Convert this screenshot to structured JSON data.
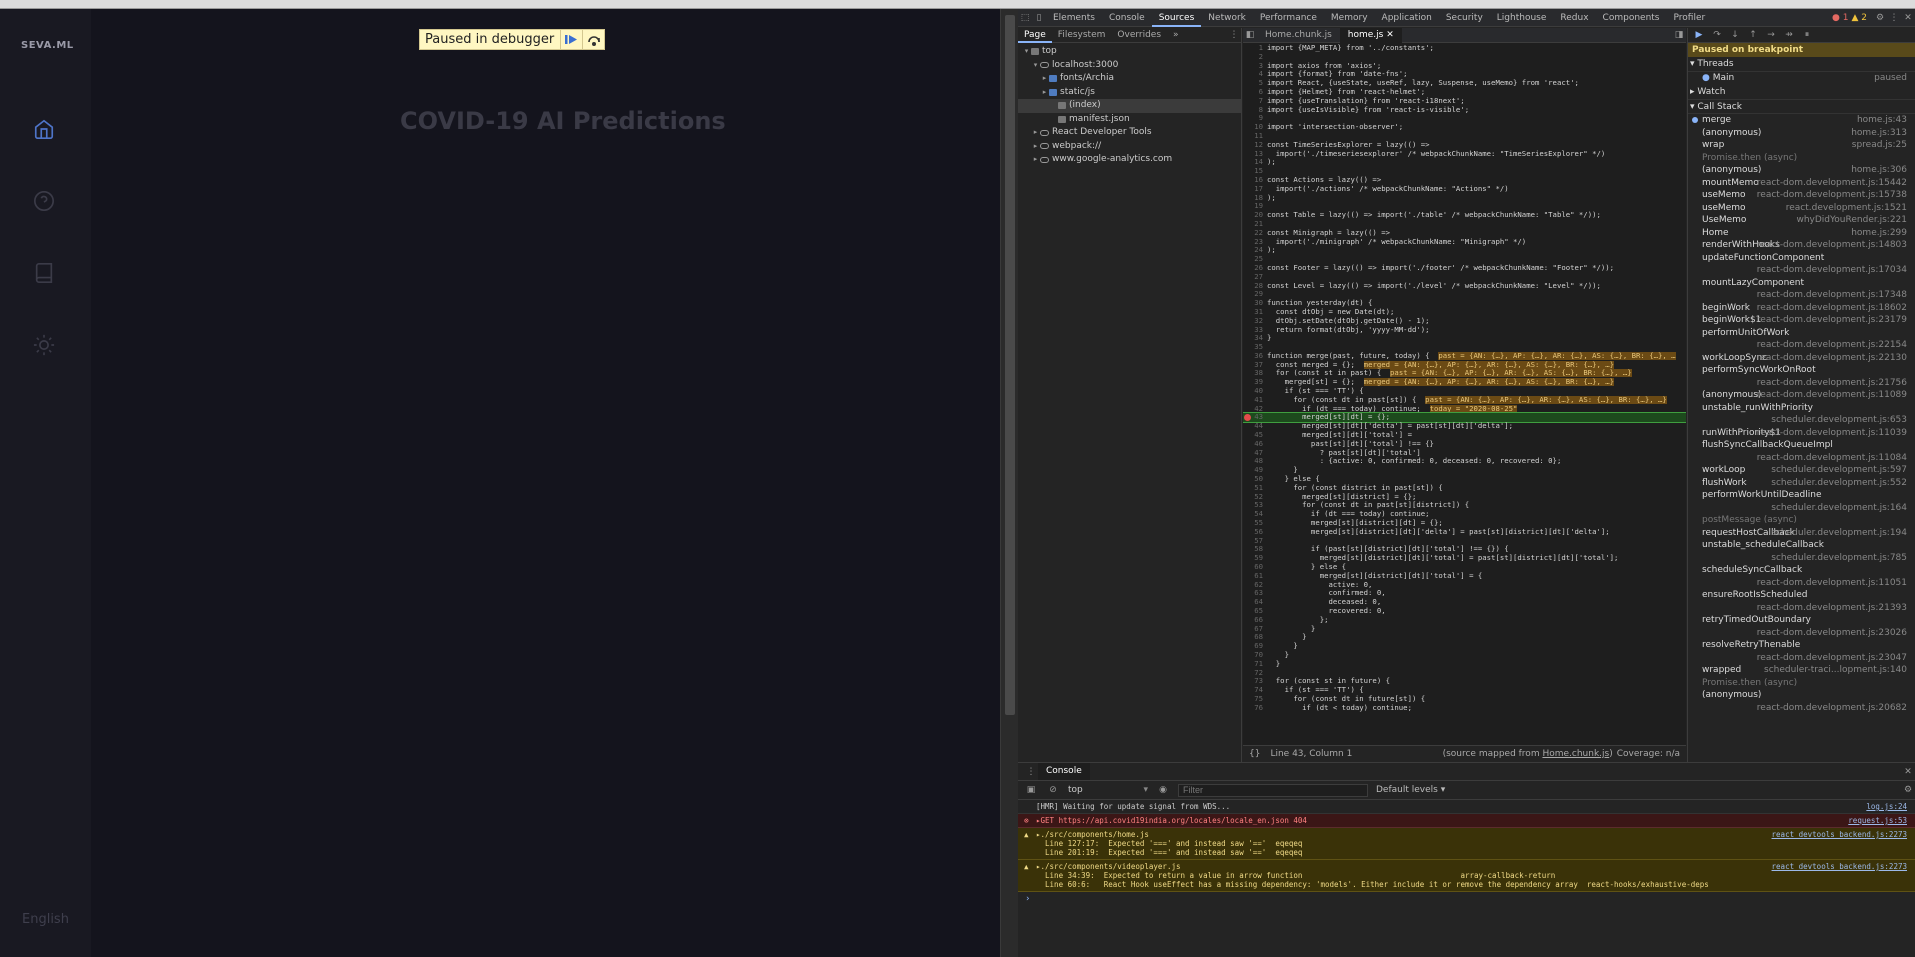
{
  "page": {
    "logo": "SEVA.ML",
    "title": "COVID-19 AI Predictions",
    "language": "English",
    "nav_icons": [
      "home-icon",
      "help-icon",
      "book-icon",
      "sun-icon"
    ]
  },
  "paused_overlay": {
    "label": "Paused in debugger"
  },
  "devtools": {
    "tabs": [
      "Elements",
      "Console",
      "Sources",
      "Network",
      "Performance",
      "Memory",
      "Application",
      "Security",
      "Lighthouse",
      "Redux",
      "Components",
      "Profiler"
    ],
    "active_tab": "Sources",
    "issues": {
      "errors": "1",
      "warnings": "2"
    },
    "navigator": {
      "tabs": [
        "Page",
        "Filesystem",
        "Overrides"
      ],
      "tree": [
        {
          "label": "top",
          "depth": 0,
          "kind": "frame"
        },
        {
          "label": "localhost:3000",
          "depth": 1,
          "kind": "cloud"
        },
        {
          "label": "fonts/Archia",
          "depth": 2,
          "kind": "folder"
        },
        {
          "label": "static/js",
          "depth": 2,
          "kind": "folder"
        },
        {
          "label": "(index)",
          "depth": 3,
          "kind": "file",
          "selected": true
        },
        {
          "label": "manifest.json",
          "depth": 3,
          "kind": "file"
        },
        {
          "label": "React Developer Tools",
          "depth": 1,
          "kind": "cloud"
        },
        {
          "label": "webpack://",
          "depth": 1,
          "kind": "cloud"
        },
        {
          "label": "www.google-analytics.com",
          "depth": 1,
          "kind": "cloud"
        }
      ]
    },
    "editor": {
      "tabs": [
        "Home.chunk.js",
        "home.js"
      ],
      "active_tab": "home.js",
      "status_position": "Line 43, Column 1",
      "status_source_prefix": "(source mapped from ",
      "status_source_link": "Home.chunk.js",
      "status_source_suffix": ")",
      "status_coverage": "Coverage: n/a",
      "lines": [
        {
          "n": "1",
          "t": "import {MAP_META} from '../constants';"
        },
        {
          "n": "2",
          "t": ""
        },
        {
          "n": "3",
          "t": "import axios from 'axios';"
        },
        {
          "n": "4",
          "t": "import {format} from 'date-fns';"
        },
        {
          "n": "5",
          "t": "import React, {useState, useRef, lazy, Suspense, useMemo} from 'react';"
        },
        {
          "n": "6",
          "t": "import {Helmet} from 'react-helmet';"
        },
        {
          "n": "7",
          "t": "import {useTranslation} from 'react-i18next';"
        },
        {
          "n": "8",
          "t": "import {useIsVisible} from 'react-is-visible';"
        },
        {
          "n": "9",
          "t": ""
        },
        {
          "n": "10",
          "t": "import 'intersection-observer';"
        },
        {
          "n": "11",
          "t": ""
        },
        {
          "n": "12",
          "t": "const TimeSeriesExplorer = lazy(() =>"
        },
        {
          "n": "13",
          "t": "  import('./timeseriesexplorer' /* webpackChunkName: \"TimeSeriesExplorer\" */)"
        },
        {
          "n": "14",
          "t": ");"
        },
        {
          "n": "15",
          "t": ""
        },
        {
          "n": "16",
          "t": "const Actions = lazy(() =>"
        },
        {
          "n": "17",
          "t": "  import('./actions' /* webpackChunkName: \"Actions\" */)"
        },
        {
          "n": "18",
          "t": ");"
        },
        {
          "n": "19",
          "t": ""
        },
        {
          "n": "20",
          "t": "const Table = lazy(() => import('./table' /* webpackChunkName: \"Table\" */));"
        },
        {
          "n": "21",
          "t": ""
        },
        {
          "n": "22",
          "t": "const Minigraph = lazy(() =>"
        },
        {
          "n": "23",
          "t": "  import('./minigraph' /* webpackChunkName: \"Minigraph\" */)"
        },
        {
          "n": "24",
          "t": ");"
        },
        {
          "n": "25",
          "t": ""
        },
        {
          "n": "26",
          "t": "const Footer = lazy(() => import('./footer' /* webpackChunkName: \"Footer\" */));"
        },
        {
          "n": "27",
          "t": ""
        },
        {
          "n": "28",
          "t": "const Level = lazy(() => import('./level' /* webpackChunkName: \"Level\" */));"
        },
        {
          "n": "29",
          "t": ""
        },
        {
          "n": "30",
          "t": "function yesterday(dt) {"
        },
        {
          "n": "31",
          "t": "  const dtObj = new Date(dt);"
        },
        {
          "n": "32",
          "t": "  dtObj.setDate(dtObj.getDate() - 1);"
        },
        {
          "n": "33",
          "t": "  return format(dtObj, 'yyyy-MM-dd');"
        },
        {
          "n": "34",
          "t": "}"
        },
        {
          "n": "35",
          "t": ""
        },
        {
          "n": "36",
          "t": "function merge(past, future, today) {",
          "i": "past = {AN: {…}, AP: {…}, AR: {…}, AS: {…}, BR: {…}, …"
        },
        {
          "n": "37",
          "t": "  const merged = {};",
          "i": "merged = {AN: {…}, AP: {…}, AR: {…}, AS: {…}, BR: {…}, …}"
        },
        {
          "n": "38",
          "t": "  for (const st in past) {",
          "i": "past = {AN: {…}, AP: {…}, AR: {…}, AS: {…}, BR: {…}, …}"
        },
        {
          "n": "39",
          "t": "    merged[st] = {};",
          "i": "merged = {AN: {…}, AP: {…}, AR: {…}, AS: {…}, BR: {…}, …}"
        },
        {
          "n": "40",
          "t": "    if (st === 'TT') {"
        },
        {
          "n": "41",
          "t": "      for (const dt in past[st]) {",
          "i": "past = {AN: {…}, AP: {…}, AR: {…}, AS: {…}, BR: {…}, …}"
        },
        {
          "n": "42",
          "t": "        if (dt === today) continue;",
          "i": "today = \"2020-08-25\""
        },
        {
          "n": "43",
          "t": "        merged[st][dt] = {};",
          "paused": true
        },
        {
          "n": "44",
          "t": "        merged[st][dt]['delta'] = past[st][dt]['delta'];"
        },
        {
          "n": "45",
          "t": "        merged[st][dt]['total'] ="
        },
        {
          "n": "46",
          "t": "          past[st][dt]['total'] !== {}"
        },
        {
          "n": "47",
          "t": "            ? past[st][dt]['total']"
        },
        {
          "n": "48",
          "t": "            : {active: 0, confirmed: 0, deceased: 0, recovered: 0};"
        },
        {
          "n": "49",
          "t": "      }"
        },
        {
          "n": "50",
          "t": "    } else {"
        },
        {
          "n": "51",
          "t": "      for (const district in past[st]) {"
        },
        {
          "n": "52",
          "t": "        merged[st][district] = {};"
        },
        {
          "n": "53",
          "t": "        for (const dt in past[st][district]) {"
        },
        {
          "n": "54",
          "t": "          if (dt === today) continue;"
        },
        {
          "n": "55",
          "t": "          merged[st][district][dt] = {};"
        },
        {
          "n": "56",
          "t": "          merged[st][district][dt]['delta'] = past[st][district][dt]['delta'];"
        },
        {
          "n": "57",
          "t": ""
        },
        {
          "n": "58",
          "t": "          if (past[st][district][dt]['total'] !== {}) {"
        },
        {
          "n": "59",
          "t": "            merged[st][district][dt]['total'] = past[st][district][dt]['total'];"
        },
        {
          "n": "60",
          "t": "          } else {"
        },
        {
          "n": "61",
          "t": "            merged[st][district][dt]['total'] = {"
        },
        {
          "n": "62",
          "t": "              active: 0,"
        },
        {
          "n": "63",
          "t": "              confirmed: 0,"
        },
        {
          "n": "64",
          "t": "              deceased: 0,"
        },
        {
          "n": "65",
          "t": "              recovered: 0,"
        },
        {
          "n": "66",
          "t": "            };"
        },
        {
          "n": "67",
          "t": "          }"
        },
        {
          "n": "68",
          "t": "        }"
        },
        {
          "n": "69",
          "t": "      }"
        },
        {
          "n": "70",
          "t": "    }"
        },
        {
          "n": "71",
          "t": "  }"
        },
        {
          "n": "72",
          "t": ""
        },
        {
          "n": "73",
          "t": "  for (const st in future) {"
        },
        {
          "n": "74",
          "t": "    if (st === 'TT') {"
        },
        {
          "n": "75",
          "t": "      for (const dt in future[st]) {"
        },
        {
          "n": "76",
          "t": "        if (dt < today) continue;"
        }
      ]
    },
    "debugger": {
      "paused_banner": "Paused on breakpoint",
      "threads_label": "Threads",
      "thread_name": "Main",
      "thread_state": "paused",
      "watch_label": "Watch",
      "callstack_label": "Call Stack",
      "frames": [
        {
          "fn": "merge",
          "loc": "home.js:43",
          "current": true
        },
        {
          "fn": "(anonymous)",
          "loc": "home.js:313"
        },
        {
          "fn": "wrap",
          "loc": "spread.js:25"
        },
        {
          "async": "Promise.then (async)"
        },
        {
          "fn": "(anonymous)",
          "loc": "home.js:306"
        },
        {
          "fn": "mountMemo",
          "loc": "react-dom.development.js:15442"
        },
        {
          "fn": "useMemo",
          "loc": "react-dom.development.js:15738"
        },
        {
          "fn": "useMemo",
          "loc": "react.development.js:1521"
        },
        {
          "fn": "UseMemo",
          "loc": "whyDidYouRender.js:221"
        },
        {
          "fn": "Home",
          "loc": "home.js:299"
        },
        {
          "fn": "renderWithHooks",
          "loc": "react-dom.development.js:14803"
        },
        {
          "fn": "updateFunctionComponent",
          "loc": "react-dom.development.js:17034",
          "two": true
        },
        {
          "fn": "mountLazyComponent",
          "loc": "react-dom.development.js:17348",
          "two": true
        },
        {
          "fn": "beginWork",
          "loc": "react-dom.development.js:18602"
        },
        {
          "fn": "beginWork$1",
          "loc": "react-dom.development.js:23179"
        },
        {
          "fn": "performUnitOfWork",
          "loc": "react-dom.development.js:22154",
          "two": true
        },
        {
          "fn": "workLoopSync",
          "loc": "react-dom.development.js:22130"
        },
        {
          "fn": "performSyncWorkOnRoot",
          "loc": "react-dom.development.js:21756",
          "two": true
        },
        {
          "fn": "(anonymous)",
          "loc": "react-dom.development.js:11089"
        },
        {
          "fn": "unstable_runWithPriority",
          "loc": "scheduler.development.js:653",
          "two": true
        },
        {
          "fn": "runWithPriority$1",
          "loc": "react-dom.development.js:11039"
        },
        {
          "fn": "flushSyncCallbackQueueImpl",
          "loc": "react-dom.development.js:11084",
          "two": true
        },
        {
          "fn": "workLoop",
          "loc": "scheduler.development.js:597"
        },
        {
          "fn": "flushWork",
          "loc": "scheduler.development.js:552"
        },
        {
          "fn": "performWorkUntilDeadline",
          "loc": "scheduler.development.js:164",
          "two": true
        },
        {
          "async": "postMessage (async)"
        },
        {
          "fn": "requestHostCallback",
          "loc": "scheduler.development.js:194"
        },
        {
          "fn": "unstable_scheduleCallback",
          "loc": "scheduler.development.js:785",
          "two": true
        },
        {
          "fn": "scheduleSyncCallback",
          "loc": "react-dom.development.js:11051",
          "two": true
        },
        {
          "fn": "ensureRootIsScheduled",
          "loc": "react-dom.development.js:21393",
          "two": true
        },
        {
          "fn": "retryTimedOutBoundary",
          "loc": "react-dom.development.js:23026",
          "two": true
        },
        {
          "fn": "resolveRetryThenable",
          "loc": "react-dom.development.js:23047",
          "two": true
        },
        {
          "fn": "wrapped",
          "loc": "scheduler-traci...lopment.js:140"
        },
        {
          "async": "Promise.then (async)"
        },
        {
          "fn": "(anonymous)",
          "loc": "react-dom.development.js:20682",
          "two": true
        }
      ]
    },
    "console": {
      "tab_label": "Console",
      "context": "top",
      "filter_placeholder": "Filter",
      "levels": "Default levels",
      "messages": [
        {
          "kind": "info",
          "text": "[HMR] Waiting for update signal from WDS...",
          "src": "log.js:24"
        },
        {
          "kind": "err",
          "text": "▸GET https://api.covid19india.org/locales/locale_en.json 404",
          "src": "request.js:53"
        },
        {
          "kind": "warn",
          "text": "▸./src/components/home.js\n  Line 127:17:  Expected '===' and instead saw '=='  eqeqeq\n  Line 201:19:  Expected '===' and instead saw '=='  eqeqeq",
          "src": "react_devtools_backend.js:2273"
        },
        {
          "kind": "warn",
          "text": "▸./src/components/videoplayer.js\n  Line 34:39:  Expected to return a value in arrow function                                   array-callback-return\n  Line 60:6:   React Hook useEffect has a missing dependency: 'models'. Either include it or remove the dependency array  react-hooks/exhaustive-deps",
          "src": "react_devtools_backend.js:2273"
        }
      ]
    }
  }
}
